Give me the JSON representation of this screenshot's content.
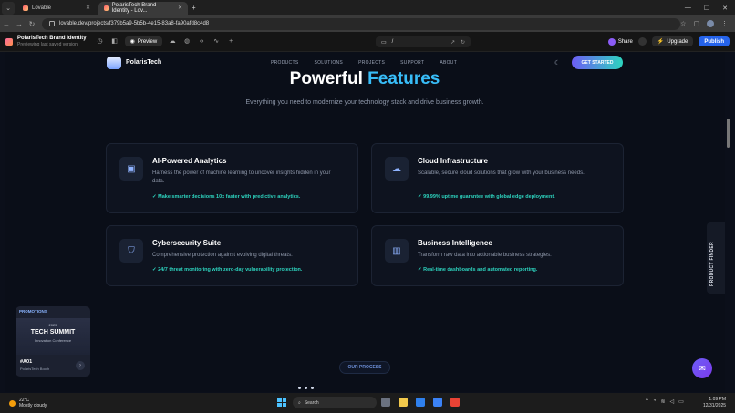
{
  "browser": {
    "tabs": [
      {
        "label": "Lovable",
        "active": false
      },
      {
        "label": "PolarisTech Brand Identity - Lov...",
        "active": true
      }
    ],
    "new_tab_glyph": "+",
    "url": "lovable.dev/projects/f379b5a9-5b5b-4e15-83a8-fa90afd8c4d8"
  },
  "lovable": {
    "project_title": "PolarisTech Brand Identity",
    "project_sub": "Previewing last saved version",
    "preview_label": "Preview",
    "path": "/",
    "share_label": "Share",
    "upgrade_label": "Upgrade",
    "publish_label": "Publish"
  },
  "site": {
    "brand": "PolarisTech",
    "nav": [
      "PRODUCTS",
      "SOLUTIONS",
      "PROJECTS",
      "SUPPORT",
      "ABOUT"
    ],
    "cta": "GET STARTED",
    "hero_title_plain": "Powerful",
    "hero_title_accent": "Features",
    "hero_subtitle": "Everything you need to modernize your technology stack and drive business growth.",
    "features": [
      {
        "title": "AI-Powered Analytics",
        "desc": "Harness the power of machine learning to uncover insights hidden in your data.",
        "highlight": "✓ Make smarter decisions 10x faster with predictive analytics.",
        "icon": "chip-icon"
      },
      {
        "title": "Cloud Infrastructure",
        "desc": "Scalable, secure cloud solutions that grow with your business needs.",
        "highlight": "✓ 99.99% uptime guarantee with global edge deployment.",
        "icon": "cloud-icon"
      },
      {
        "title": "Cybersecurity Suite",
        "desc": "Comprehensive protection against evolving digital threats.",
        "highlight": "✓ 24/7 threat monitoring with zero-day vulnerability protection.",
        "icon": "shield-icon"
      },
      {
        "title": "Business Intelligence",
        "desc": "Transform raw data into actionable business strategies.",
        "highlight": "✓ Real-time dashboards and automated reporting.",
        "icon": "bar-chart-icon"
      }
    ],
    "promo": {
      "header": "PROMOTIONS",
      "year": "2025",
      "title": "TECH SUMMIT",
      "subtitle": "Innovation Conference",
      "code": "#A01",
      "location": "PolarisTech Booth"
    },
    "process_pill": "OUR PROCESS",
    "product_finder": "PRODUCT FINDER"
  },
  "taskbar": {
    "temp": "22°C",
    "weather": "Mostly cloudy",
    "search": "Search",
    "time": "1:09 PM",
    "date": "12/31/2025"
  },
  "colors": {
    "accent": "#38bdf8",
    "highlight": "#2dd4bf",
    "publish": "#2563eb",
    "cta_start": "#6d5df5"
  }
}
